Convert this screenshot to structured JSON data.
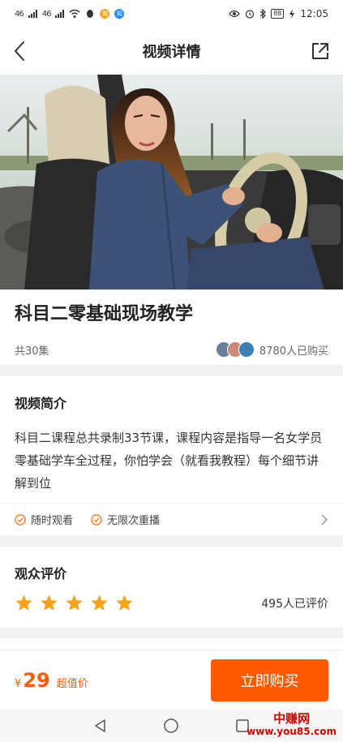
{
  "status_bar": {
    "signal1": "46",
    "signal2": "46",
    "battery": "88",
    "time": "12:05",
    "icons": [
      "signal-icon",
      "wifi-icon",
      "qq-icon",
      "taobao-icon",
      "zhihu-icon",
      "eye-icon",
      "alarm-icon",
      "bluetooth-icon",
      "battery-icon",
      "charging-icon"
    ]
  },
  "header": {
    "title": "视频详情",
    "back_icon": "chevron-left-icon",
    "share_icon": "share-icon"
  },
  "course": {
    "title": "科目二零基础现场教学",
    "episodes": "共30集",
    "buyers": "8780人已购买"
  },
  "intro": {
    "title": "视频简介",
    "text": "科目二课程总共录制33节课，课程内容是指导一名女学员零基础学车全过程，你怕学会（就看我教程）每个细节讲解到位",
    "features": [
      "随时观看",
      "无限次重播"
    ]
  },
  "review": {
    "title": "观众评价",
    "stars": 5,
    "count": "495人已评价"
  },
  "buy_bar": {
    "currency": "¥",
    "price": "29",
    "price_tag": "超值价",
    "button_label": "立即购买"
  },
  "watermark": {
    "line1": "中赚网",
    "line2": "www.you85.com"
  },
  "colors": {
    "accent": "#ff5a00",
    "star": "#f7a21b",
    "feature_icon": "#ff7a2a"
  }
}
